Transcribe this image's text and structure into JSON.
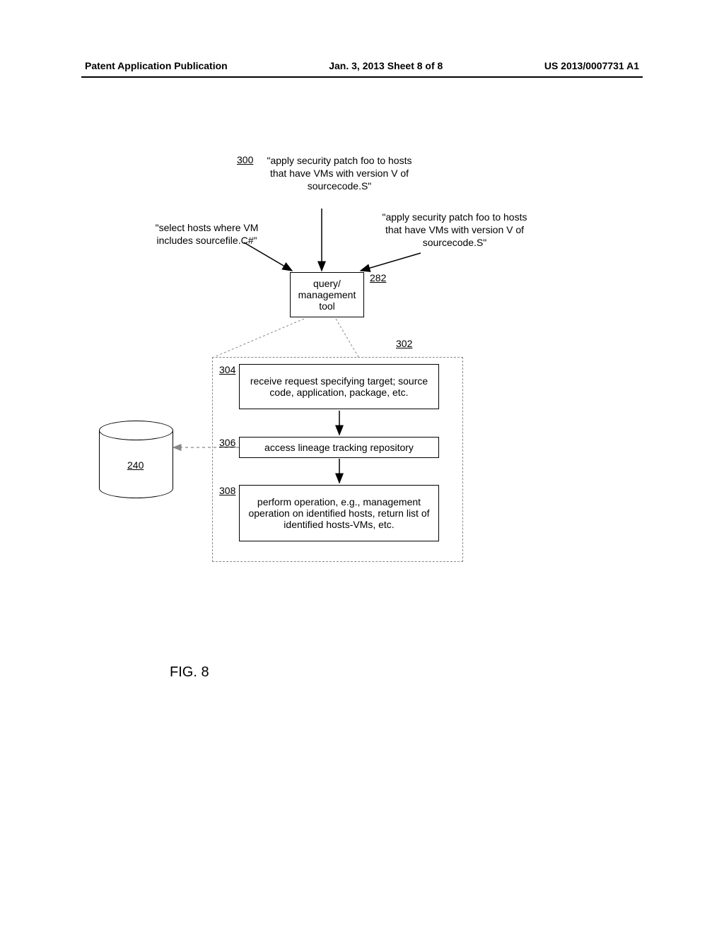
{
  "header": {
    "left": "Patent Application Publication",
    "center": "Jan. 3, 2013  Sheet 8 of 8",
    "right": "US 2013/0007731 A1"
  },
  "diagram": {
    "ref300": "300",
    "query_top": "\"apply security patch foo to hosts that have VMs with version V of sourcecode.S\"",
    "query_left": "\"select hosts where VM includes sourcefile.C#\"",
    "query_right": "\"apply security patch foo to hosts that have VMs with version V of sourcecode.S\"",
    "ref282": "282",
    "tool_box": "query/ management tool",
    "ref302": "302",
    "ref304": "304",
    "step304": "receive request specifying target; source code, application, package, etc.",
    "ref306": "306",
    "step306": "access lineage tracking repository",
    "ref308": "308",
    "step308": "perform operation, e.g., management operation on identified hosts, return list of identified hosts-VMs, etc.",
    "ref240": "240"
  },
  "figure_label": "FIG. 8"
}
